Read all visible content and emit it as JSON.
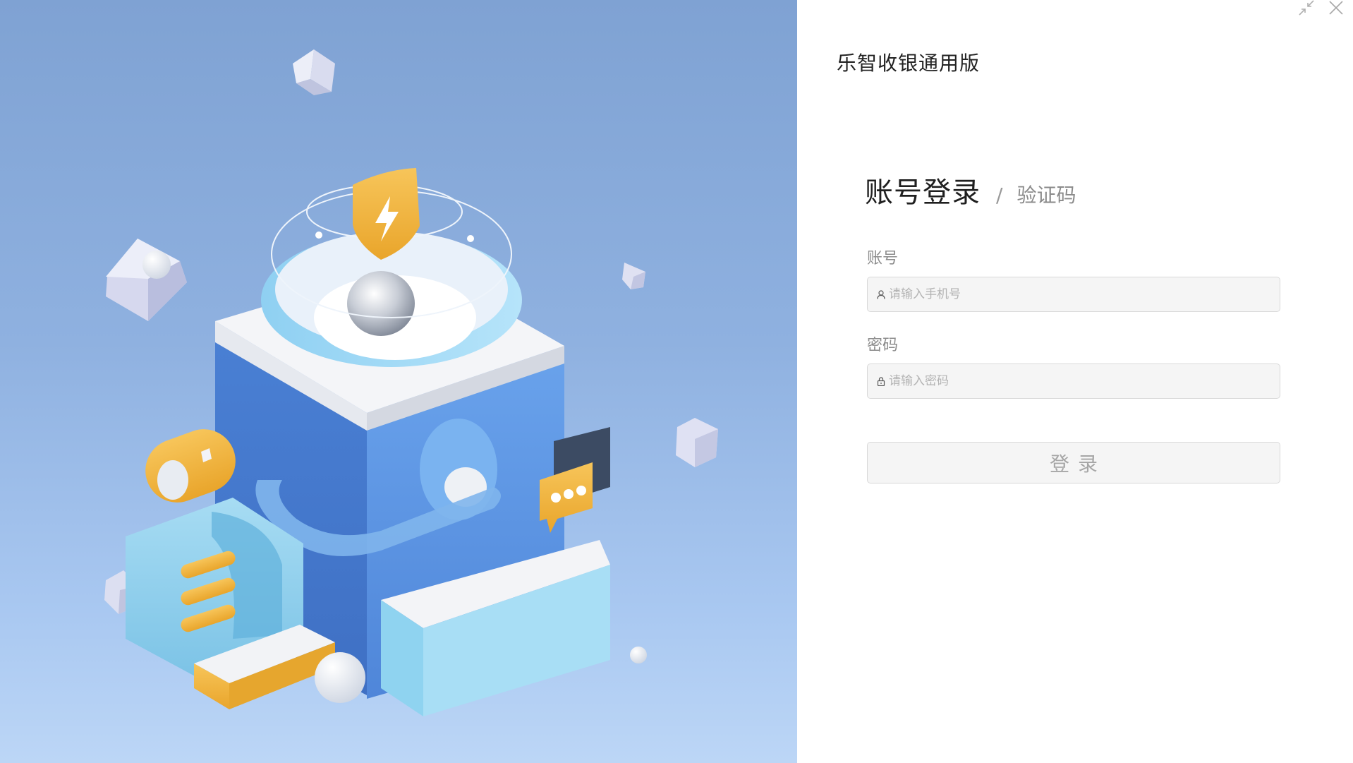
{
  "window": {
    "controls": [
      {
        "name": "minimize",
        "icon": "shrink-arrows-icon"
      },
      {
        "name": "close",
        "icon": "close-icon"
      }
    ]
  },
  "app": {
    "title": "乐智收银通用版"
  },
  "login": {
    "tabs": {
      "active_label": "账号登录",
      "separator": "/",
      "inactive_label": "验证码"
    },
    "account": {
      "label": "账号",
      "placeholder": "请输入手机号",
      "value": "",
      "icon": "user-icon"
    },
    "password": {
      "label": "密码",
      "placeholder": "请输入密码",
      "value": "",
      "icon": "lock-icon"
    },
    "submit_label": "登录"
  },
  "colors": {
    "hero_background": "#8fb1e0",
    "cube_blue": "#5b93e3",
    "accent_yellow": "#f0b43c",
    "input_background": "#f5f5f5",
    "input_border": "#d9d9d9"
  }
}
